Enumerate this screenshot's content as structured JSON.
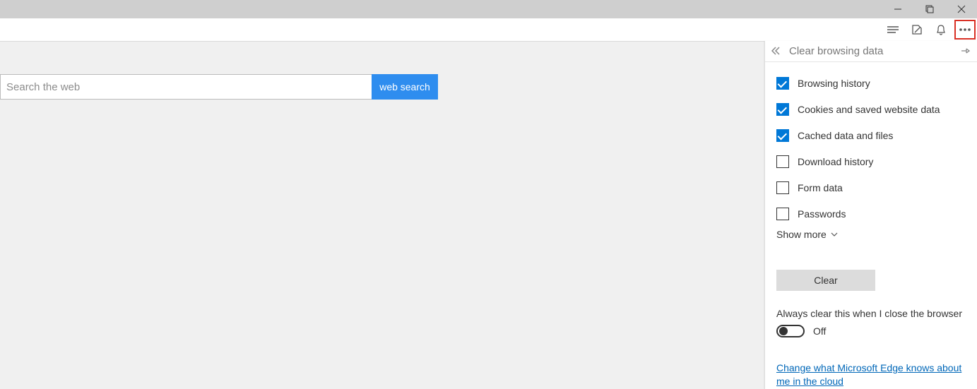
{
  "search": {
    "placeholder": "Search the web",
    "button": "web search"
  },
  "panel": {
    "title": "Clear browsing data",
    "items": [
      {
        "label": "Browsing history",
        "checked": true
      },
      {
        "label": "Cookies and saved website data",
        "checked": true
      },
      {
        "label": "Cached data and files",
        "checked": true
      },
      {
        "label": "Download history",
        "checked": false
      },
      {
        "label": "Form data",
        "checked": false
      },
      {
        "label": "Passwords",
        "checked": false
      }
    ],
    "show_more": "Show more",
    "clear": "Clear",
    "always": "Always clear this when I close the browser",
    "toggle_state": "Off",
    "link": "Change what Microsoft Edge knows about me in the cloud"
  }
}
